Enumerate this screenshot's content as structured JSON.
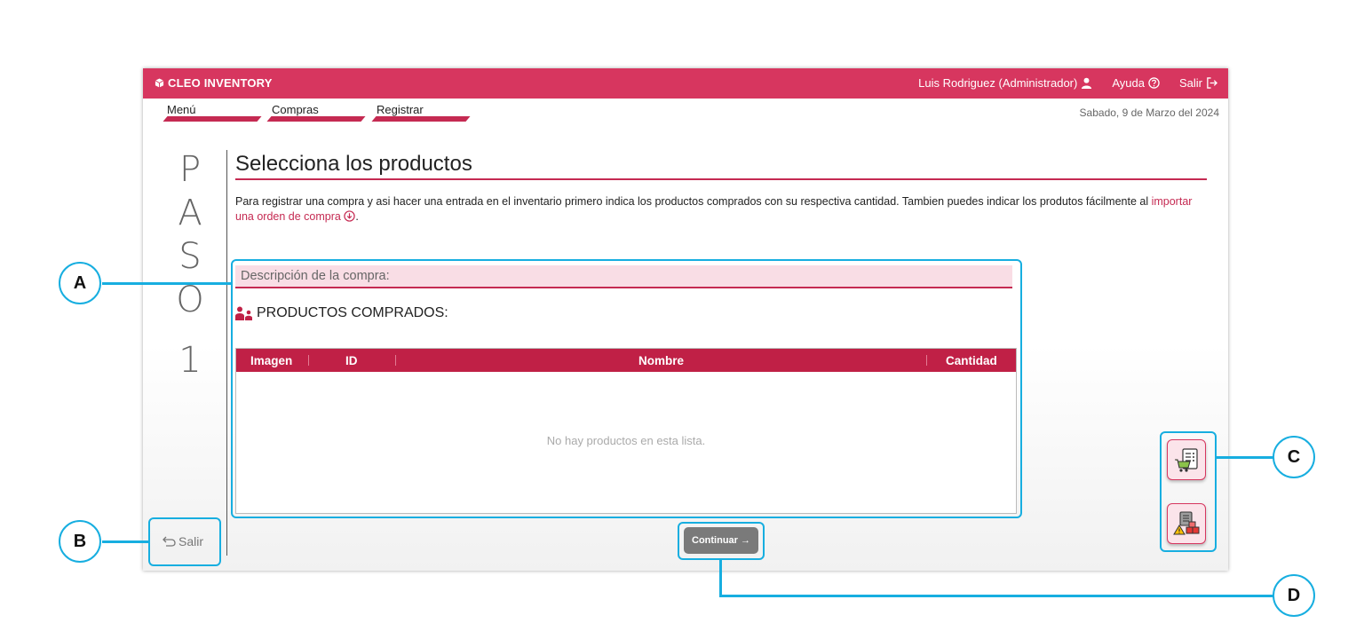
{
  "header": {
    "brand": "CLEO INVENTORY",
    "user": "Luis Rodriguez (Administrador)",
    "help": "Ayuda",
    "logout": "Salir",
    "color": "#d7365f"
  },
  "breadcrumb": [
    "Menú",
    "Compras",
    "Registrar"
  ],
  "date": "Sabado, 9 de Marzo del 2024",
  "step": {
    "word": [
      "P",
      "A",
      "S",
      "O"
    ],
    "number": "1"
  },
  "main": {
    "title": "Selecciona los productos",
    "desc_text": "Para registrar una compra y asi hacer una entrada en el inventario primero indica los productos comprados con su respectiva cantidad. Tambien puedes indicar los produtos fácilmente al",
    "desc_link": "importar una orden de compra",
    "desc_end": ".",
    "purchase_description_label": "Descripción de la compra:",
    "products_title": "PRODUCTOS COMPRADOS:",
    "table": {
      "columns": [
        "Imagen",
        "ID",
        "Nombre",
        "Cantidad"
      ],
      "empty_message": "No hay productos en esta lista."
    }
  },
  "footer": {
    "exit_label": "Salir",
    "continue_label": "Continuar →"
  },
  "side_actions": [
    {
      "icon": "purchase-order-import-icon"
    },
    {
      "icon": "inventory-warning-icon"
    }
  ],
  "annotations": [
    "A",
    "B",
    "C",
    "D"
  ]
}
